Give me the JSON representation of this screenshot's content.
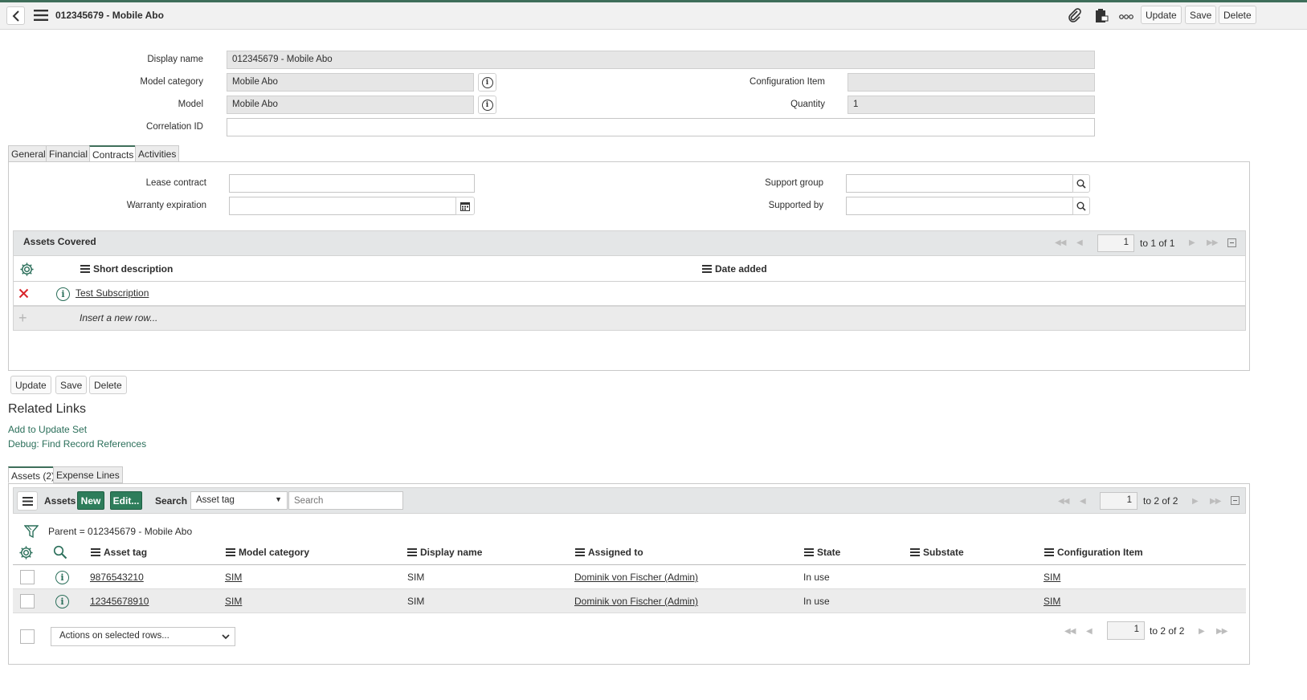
{
  "header": {
    "title": "012345679 - Mobile Abo",
    "buttons": {
      "update": "Update",
      "save": "Save",
      "delete": "Delete"
    }
  },
  "form": {
    "display_name": {
      "label": "Display name",
      "value": "012345679 - Mobile Abo"
    },
    "model_category": {
      "label": "Model category",
      "value": "Mobile Abo"
    },
    "model": {
      "label": "Model",
      "value": "Mobile Abo"
    },
    "correlation_id": {
      "label": "Correlation ID",
      "value": ""
    },
    "configuration_item": {
      "label": "Configuration Item",
      "value": ""
    },
    "quantity": {
      "label": "Quantity",
      "value": "1"
    }
  },
  "tabs": [
    "General",
    "Financial",
    "Contracts",
    "Activities"
  ],
  "active_tab": "Contracts",
  "contracts": {
    "lease_contract": {
      "label": "Lease contract",
      "value": ""
    },
    "warranty_expiration": {
      "label": "Warranty expiration",
      "value": ""
    },
    "support_group": {
      "label": "Support group",
      "value": ""
    },
    "supported_by": {
      "label": "Supported by",
      "value": ""
    },
    "assets_covered": {
      "title": "Assets Covered",
      "page": "1",
      "range": "to 1 of 1",
      "columns": [
        "Short description",
        "Date added"
      ],
      "rows": [
        {
          "short_description": "Test Subscription",
          "date_added": ""
        }
      ],
      "insert_text": "Insert a new row..."
    }
  },
  "bottom_buttons": {
    "update": "Update",
    "save": "Save",
    "delete": "Delete"
  },
  "related_links": {
    "title": "Related Links",
    "links": [
      "Add to Update Set",
      "Debug: Find Record References"
    ]
  },
  "related_tabs": [
    "Assets (2)",
    "Expense Lines"
  ],
  "assets_list": {
    "title": "Assets",
    "new_label": "New",
    "edit_label": "Edit...",
    "search_label": "Search",
    "search_field": "Asset tag",
    "search_placeholder": "Search",
    "page": "1",
    "range": "to 2 of 2",
    "filter": "Parent = 012345679 - Mobile Abo",
    "columns": [
      "Asset tag",
      "Model category",
      "Display name",
      "Assigned to",
      "State",
      "Substate",
      "Configuration Item"
    ],
    "rows": [
      {
        "asset_tag": "9876543210",
        "model_category": "SIM",
        "display_name": "SIM",
        "assigned_to": "Dominik von Fischer (Admin)",
        "state": "In use",
        "substate": "",
        "configuration_item": "SIM"
      },
      {
        "asset_tag": "12345678910",
        "model_category": "SIM",
        "display_name": "SIM",
        "assigned_to": "Dominik von Fischer (Admin)",
        "state": "In use",
        "substate": "",
        "configuration_item": "SIM"
      }
    ],
    "actions_placeholder": "Actions on selected rows...",
    "footer_page": "1",
    "footer_range": "to 2 of 2"
  },
  "colors": {
    "accent": "#2e7d5b",
    "link": "#2b6f5a",
    "delete_x": "#d9262b"
  }
}
